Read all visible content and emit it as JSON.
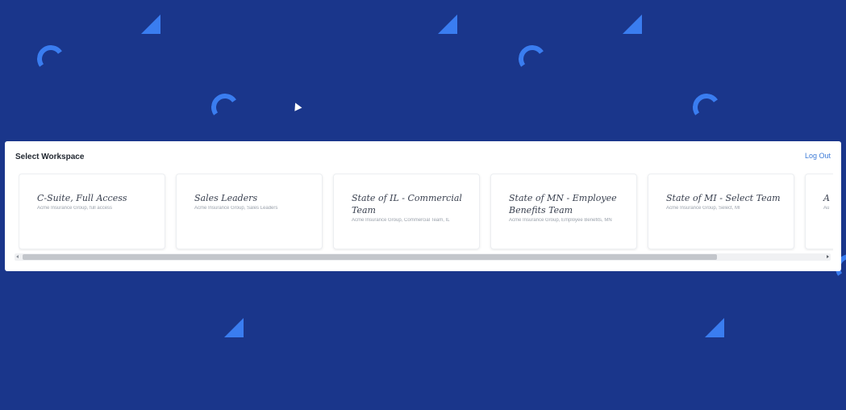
{
  "panel": {
    "title": "Select Workspace",
    "logout_label": "Log Out"
  },
  "workspaces": [
    {
      "title": "C-Suite, Full Access",
      "subtitle": "Acme Insurance Group, full access"
    },
    {
      "title": "Sales Leaders",
      "subtitle": "Acme Insurance Group, Sales Leaders"
    },
    {
      "title": "State of IL - Commercial Team",
      "subtitle": "Acme Insurance Group, Commercial Team, IL"
    },
    {
      "title": "State of MN - Employee Benefits Team",
      "subtitle": "Acme Insurance Group, Employee Benefits, MN"
    },
    {
      "title": "State of MI - Select Team",
      "subtitle": "Acme Insurance Group, Select, MI"
    },
    {
      "title": "A",
      "subtitle": "Au"
    }
  ],
  "scroll": {
    "position_fraction": 0.0,
    "visible_fraction": 0.86
  },
  "colors": {
    "background": "#1a368b",
    "accent_shapes": "#3a7df0",
    "link": "#3d7bd8"
  },
  "icons": {
    "decor_triangle": "triangle-shape",
    "decor_arc": "arc-shape",
    "cursor": "mouse-pointer-icon"
  }
}
